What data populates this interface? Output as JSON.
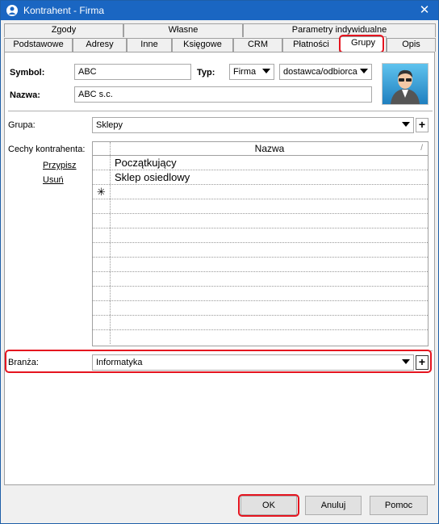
{
  "window": {
    "title": "Kontrahent - Firma",
    "close_glyph": "✕",
    "app_icon": "contractor-app-icon"
  },
  "tabs_row1": [
    {
      "label": "Zgody"
    },
    {
      "label": "Własne"
    },
    {
      "label": "Parametry indywidualne"
    }
  ],
  "tabs_row2": [
    {
      "label": "Podstawowe"
    },
    {
      "label": "Adresy"
    },
    {
      "label": "Inne"
    },
    {
      "label": "Księgowe"
    },
    {
      "label": "CRM"
    },
    {
      "label": "Płatności"
    },
    {
      "label": "Grupy",
      "active": true
    },
    {
      "label": "Opis"
    }
  ],
  "form": {
    "symbol_label": "Symbol:",
    "symbol_value": "ABC",
    "typ_label": "Typ:",
    "typ_value": "Firma",
    "role_value": "dostawca/odbiorca",
    "nazwa_label": "Nazwa:",
    "nazwa_value": "ABC s.c.",
    "grupa_label": "Grupa:",
    "grupa_value": "Sklepy",
    "cechy_label": "Cechy kontrahenta:",
    "przypisz_link": "Przypisz",
    "usun_link": "Usuń",
    "branza_label": "Branża:",
    "branza_value": "Informatyka",
    "plus_glyph": "+"
  },
  "grid": {
    "column_header": "Nazwa",
    "sort_glyph": "/",
    "rows": [
      "Początkujący",
      "Sklep osiedlowy"
    ],
    "new_row_glyph": "✳"
  },
  "buttons": {
    "ok": "OK",
    "cancel": "Anuluj",
    "help": "Pomoc"
  },
  "colors": {
    "titlebar": "#1a66c2",
    "highlight": "#e5141f"
  }
}
